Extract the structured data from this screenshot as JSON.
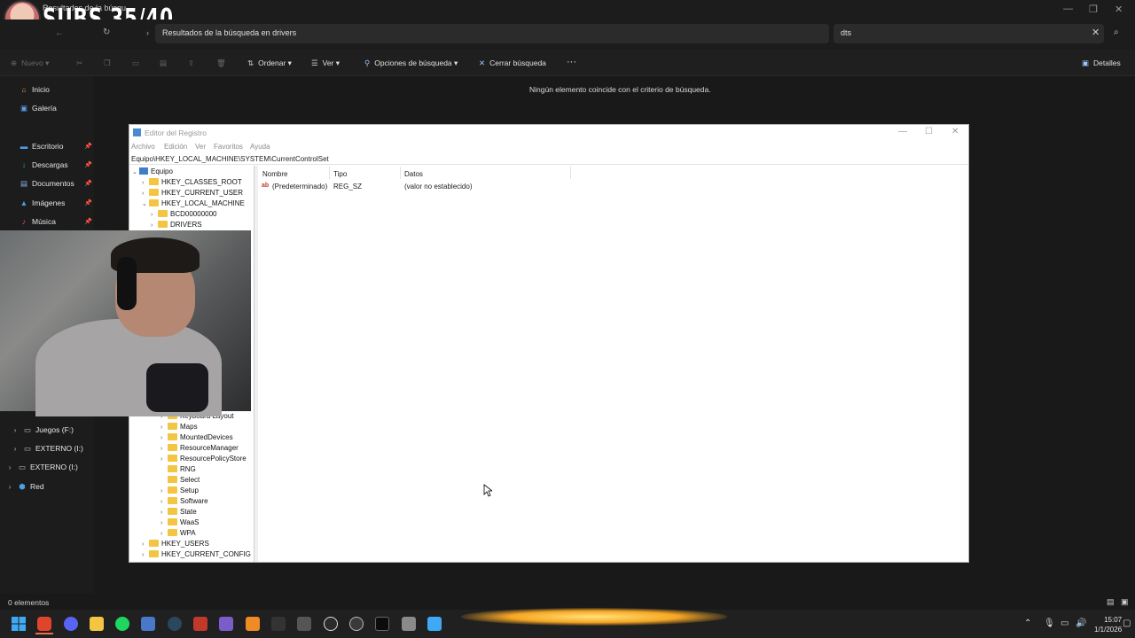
{
  "overlay": {
    "subs_counter": "SUBS 35/40",
    "tab_title": "Resultados de la búsqu..."
  },
  "explorer": {
    "address": "Resultados de la búsqueda en drivers",
    "search_value": "dts",
    "toolbar": {
      "new": "Nuevo",
      "sort": "Ordenar",
      "view": "Ver",
      "search_options": "Opciones de búsqueda",
      "close_search": "Cerrar búsqueda",
      "more": "···",
      "details": "Detalles"
    },
    "sidebar": {
      "items": [
        {
          "label": "Inicio",
          "icon": "home-icon",
          "pinned": false
        },
        {
          "label": "Galería",
          "icon": "gallery-icon",
          "pinned": false
        },
        {
          "label": "Escritorio",
          "icon": "desktop-icon",
          "pinned": true
        },
        {
          "label": "Descargas",
          "icon": "download-icon",
          "pinned": true
        },
        {
          "label": "Documentos",
          "icon": "documents-icon",
          "pinned": true
        },
        {
          "label": "Imágenes",
          "icon": "pictures-icon",
          "pinned": true
        },
        {
          "label": "Música",
          "icon": "music-icon",
          "pinned": true
        }
      ],
      "drives": [
        {
          "label": "Juegos (F:)"
        },
        {
          "label": "EXTERNO (I:)"
        },
        {
          "label": "EXTERNO (I:)"
        },
        {
          "label": "Red"
        }
      ]
    },
    "empty_message": "Ningún elemento coincide con el criterio de búsqueda.",
    "status": "0 elementos"
  },
  "regedit": {
    "title": "Editor del Registro",
    "menu": [
      "Archivo",
      "Edición",
      "Ver",
      "Favoritos",
      "Ayuda"
    ],
    "path": "Equipo\\HKEY_LOCAL_MACHINE\\SYSTEM\\CurrentControlSet",
    "tree_top": [
      {
        "label": "Equipo",
        "expander": "v"
      },
      {
        "label": "HKEY_CLASSES_ROOT",
        "expander": ">"
      },
      {
        "label": "HKEY_CURRENT_USER",
        "expander": ">"
      },
      {
        "label": "HKEY_LOCAL_MACHINE",
        "expander": "v"
      },
      {
        "label": "BCD00000000",
        "expander": ">"
      },
      {
        "label": "DRIVERS",
        "expander": ">"
      }
    ],
    "tree_bottom": [
      {
        "label": "Keyboard Layout",
        "expander": ">"
      },
      {
        "label": "Maps",
        "expander": ">"
      },
      {
        "label": "MountedDevices",
        "expander": ">"
      },
      {
        "label": "ResourceManager",
        "expander": ">"
      },
      {
        "label": "ResourcePolicyStore",
        "expander": ">"
      },
      {
        "label": "RNG",
        "expander": ">"
      },
      {
        "label": "Select",
        "expander": ""
      },
      {
        "label": "Setup",
        "expander": ">"
      },
      {
        "label": "Software",
        "expander": ">"
      },
      {
        "label": "State",
        "expander": ">"
      },
      {
        "label": "WaaS",
        "expander": ">"
      },
      {
        "label": "WPA",
        "expander": ">"
      },
      {
        "label": "HKEY_USERS",
        "expander": ">"
      },
      {
        "label": "HKEY_CURRENT_CONFIG",
        "expander": ">"
      }
    ],
    "columns": [
      "Nombre",
      "Tipo",
      "Datos"
    ],
    "rows": [
      {
        "name": "(Predeterminado)",
        "type": "REG_SZ",
        "data": "(valor no establecido)"
      }
    ]
  },
  "taskbar": {
    "time": "15:07",
    "date": "1/1/2026",
    "apps": [
      "start",
      "brave",
      "discord",
      "file-explorer",
      "spotify",
      "chat",
      "steam",
      "game",
      "vpn",
      "app-a",
      "app-b",
      "app-n",
      "chatgpt",
      "obs",
      "terminal",
      "archive",
      "network"
    ]
  },
  "colors": {
    "explorer_bg": "#191919",
    "accent": "#4a8ad1",
    "folder": "#f4c542"
  }
}
